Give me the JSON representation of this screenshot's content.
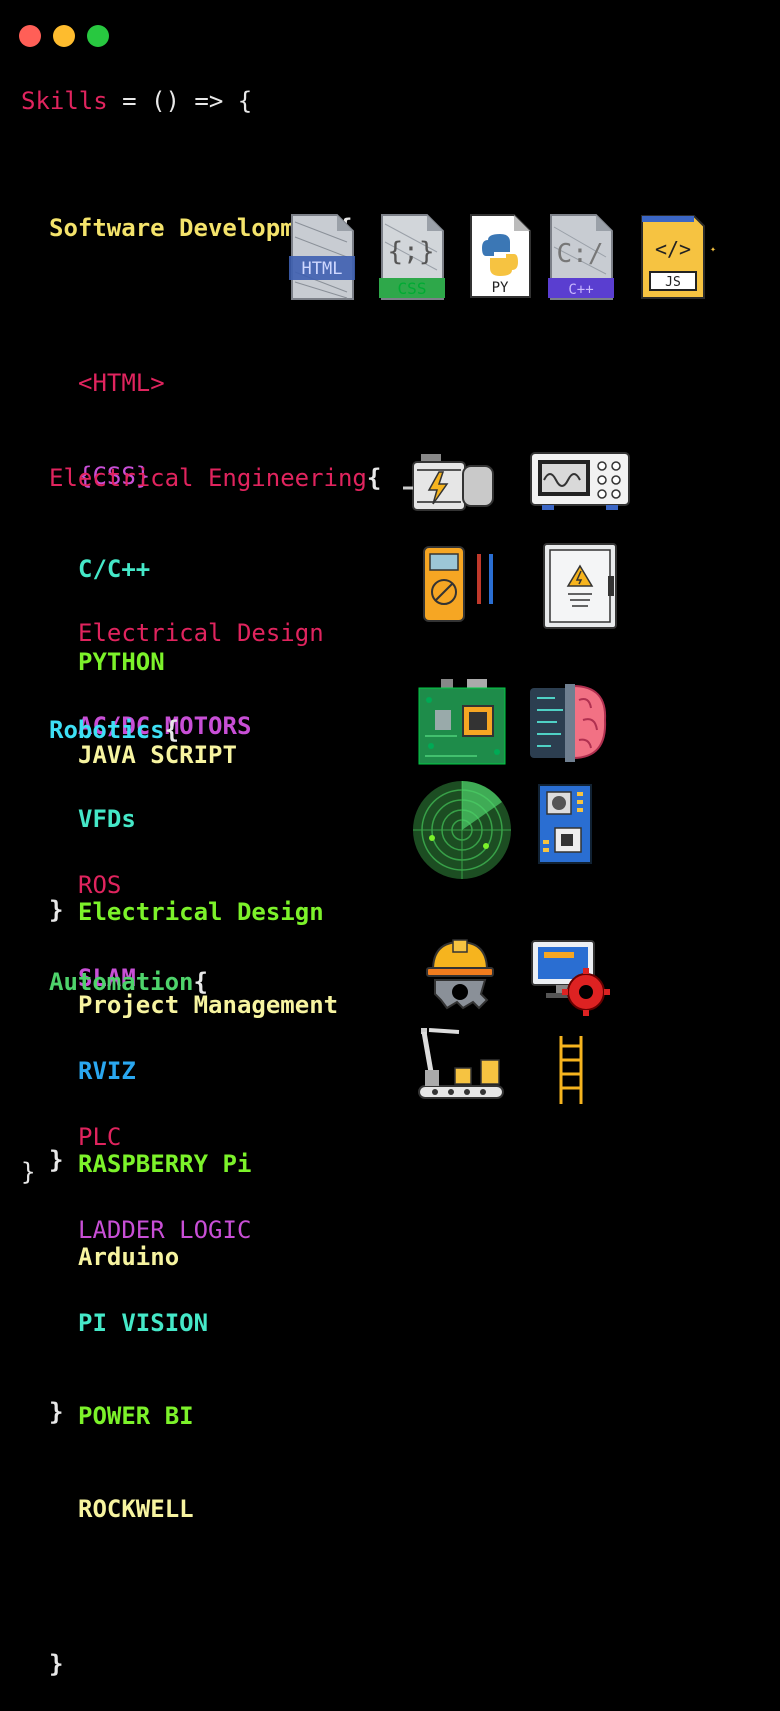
{
  "window": {
    "buttons": [
      {
        "name": "close",
        "color": "#ff5f57"
      },
      {
        "name": "minimize",
        "color": "#febc2e"
      },
      {
        "name": "maximize",
        "color": "#28c840"
      }
    ]
  },
  "code": {
    "func_name": "Skills",
    "func_rest": " = () => {",
    "closing": "}",
    "sections": [
      {
        "title": "Software Development",
        "title_color": "#f4e36b",
        "items": [
          {
            "text": "<HTML>",
            "color": "#e0245e"
          },
          {
            "text": "{CSS}",
            "color": "#c84fd6"
          },
          {
            "text": "C/C++",
            "color": "#45e8c8"
          },
          {
            "text": "PYTHON",
            "color": "#7cf22a"
          },
          {
            "text": "JAVA SCRIPT",
            "color": "#f7f4a0"
          }
        ],
        "icons": [
          "html-file-icon",
          "css-file-icon",
          "python-file-icon",
          "cpp-file-icon",
          "js-file-icon"
        ],
        "icon_labels": [
          "HTML",
          "CSS",
          "PY",
          "C++",
          "JS"
        ]
      },
      {
        "title": "Electrical Engineering",
        "title_color": "#e0245e",
        "items": [
          {
            "text": "Electrical Design",
            "color": "#e0245e"
          },
          {
            "text": "AC/DC MOTORS",
            "color": "#c84fd6"
          },
          {
            "text": "VFDs",
            "color": "#45e8c8"
          },
          {
            "text": "Electrical Design",
            "color": "#7cf22a"
          },
          {
            "text": "Project Management",
            "color": "#f7f4a0"
          }
        ],
        "icons": [
          "electric-motor-icon",
          "oscilloscope-icon",
          "multimeter-icon",
          "electrical-panel-icon"
        ]
      },
      {
        "title": "Robotics",
        "title_color": "#3ee0f5",
        "items": [
          {
            "text": "ROS",
            "color": "#e0245e"
          },
          {
            "text": "SLAM",
            "color": "#c84fd6"
          },
          {
            "text": "RVIZ",
            "color": "#2aa7f0"
          },
          {
            "text": "RASPBERRY Pi",
            "color": "#7cf22a"
          },
          {
            "text": "Arduino",
            "color": "#f7f4a0"
          }
        ],
        "icons": [
          "circuit-board-icon",
          "ai-brain-icon",
          "radar-icon",
          "microcontroller-icon"
        ]
      },
      {
        "title": "Automation",
        "title_color": "#4ed36b",
        "items": [
          {
            "text": "PLC",
            "color": "#e0245e"
          },
          {
            "text": "LADDER LOGIC",
            "color": "#c84fd6"
          },
          {
            "text": "PI VISION",
            "color": "#45e8c8"
          },
          {
            "text": "POWER BI",
            "color": "#7cf22a"
          },
          {
            "text": "ROCKWELL",
            "color": "#f7f4a0"
          }
        ],
        "icons": [
          "engineering-helmet-gear-icon",
          "computer-gear-icon",
          "robot-arm-conveyor-icon",
          "ladder-icon"
        ]
      }
    ]
  }
}
